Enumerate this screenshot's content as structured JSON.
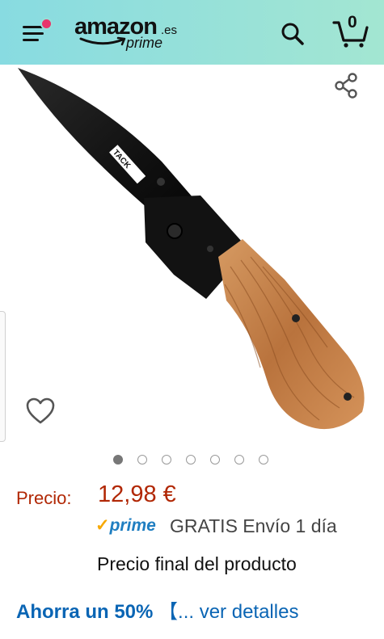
{
  "header": {
    "logo_word": "amazon",
    "logo_tld": ".es",
    "logo_prime": "prime",
    "cart_count": "0",
    "icons": [
      "menu-icon",
      "search-icon",
      "cart-icon"
    ],
    "notification_color": "#e8336b"
  },
  "gallery": {
    "image_count": 7,
    "active_index": 0,
    "icons": [
      "share-icon",
      "heart-icon"
    ]
  },
  "product": {
    "price_label": "Precio:",
    "price_value": "12,98 €",
    "prime_check": "✓",
    "prime_word": "prime",
    "shipping_text": "GRATIS Envío 1 día",
    "final_price_text": "Precio final del producto",
    "savings_strong": "Ahorra un 50%",
    "savings_rest": " 【... ver detalles",
    "price_color": "#b12704",
    "link_color": "#0a65b4"
  }
}
